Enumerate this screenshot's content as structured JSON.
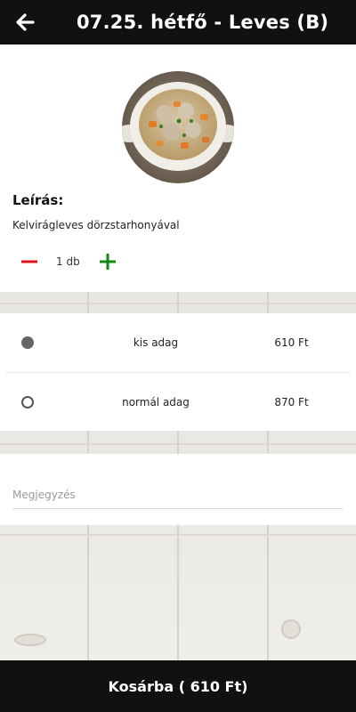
{
  "header": {
    "title": "07.25. hétfő - Leves (B)",
    "back_icon": "arrow-left-icon"
  },
  "product": {
    "image_icon": "soup-bowl-image",
    "description_heading": "Leírás:",
    "description": "Kelvirágleves dörzstarhonyával",
    "quantity_label": "1 db",
    "minus_icon": "minus-icon",
    "plus_icon": "plus-icon",
    "minus_color": "#e0111a",
    "plus_color": "#118a11"
  },
  "portions": [
    {
      "name": "kis adag",
      "price": "610 Ft",
      "selected": true
    },
    {
      "name": "normál adag",
      "price": "870 Ft",
      "selected": false
    }
  ],
  "note": {
    "placeholder": "Megjegyzés",
    "value": ""
  },
  "cart": {
    "label": "Kosárba ( 610 Ft)"
  }
}
